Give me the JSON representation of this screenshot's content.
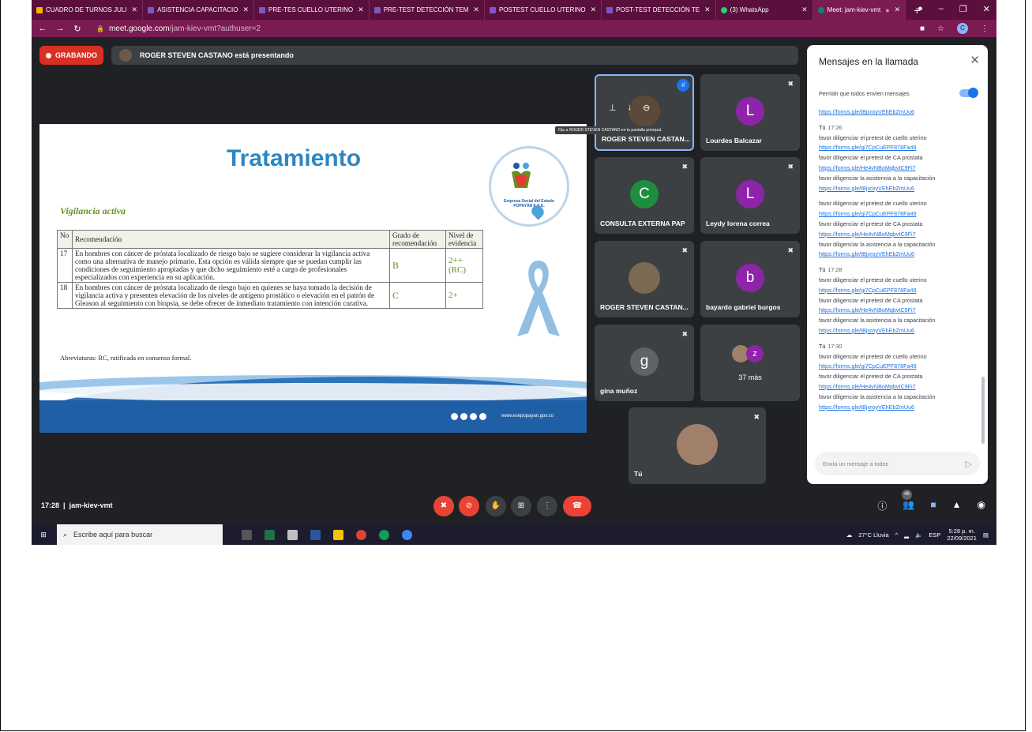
{
  "browser": {
    "tabs": [
      {
        "label": "CUADRO DE TURNOS JULI",
        "color": "#f4b400"
      },
      {
        "label": "ASISTENCIA CAPACITACIO",
        "color": "#7e57c2"
      },
      {
        "label": "PRE-TES CUELLO UTERINO",
        "color": "#7e57c2"
      },
      {
        "label": "PRE-TEST DETECCIÓN TEM",
        "color": "#7e57c2"
      },
      {
        "label": "POSTEST CUELLO UTERINO",
        "color": "#7e57c2"
      },
      {
        "label": "POST-TEST DETECCIÓN TE",
        "color": "#7e57c2"
      },
      {
        "label": "(3) WhatsApp",
        "color": "#25d366"
      },
      {
        "label": "Meet: jam-kiev-vmt",
        "color": "#00897b"
      }
    ],
    "new_tab": "+",
    "url_host": "meet.google.com",
    "url_path": "/jam-kiev-vmt?authuser=2",
    "profile_initial": "C"
  },
  "meet": {
    "recording_label": "GRABANDO",
    "presenting_text": "ROGER STEVEN CASTANO está presentando",
    "meeting_time": "17:28",
    "meeting_code": "jam-kiev-vmt",
    "participants_badge": "46",
    "pin_tooltip": "Fija a ROGER STEVEN CASTANO en tu pantalla principal."
  },
  "slide": {
    "title": "Tratamiento",
    "subtitle": "Vigilancia activa",
    "logo_text": "Empresa Social del Estado POPAYÁN E.S.E.",
    "table_headers": [
      "No",
      "Recomendación",
      "Grado de recomendación",
      "Nivel de evidencia"
    ],
    "rows": [
      {
        "no": "17",
        "text": "En hombres con cáncer de próstata localizado de riesgo bajo se sugiere considerar la vigilancia activa como una alternativa de manejo primario. Esta opción es válida siempre que se puedan cumplir las condiciones de seguimiento apropiadas y que dicho seguimiento esté a cargo de profesionales especializados con experiencia en su aplicación.",
        "grade": "B",
        "level": "2++ (RC)"
      },
      {
        "no": "18",
        "text": "En hombres con cáncer de próstata localizado de riesgo bajo en quienes se haya tomado la decisión de vigilancia activa y presenten elevación de los niveles de antígeno prostático o elevación en el patrón de Gleason al seguimiento con biopsia, se debe ofrecer de inmediato tratamiento con intención curativa.",
        "grade": "C",
        "level": "2+"
      }
    ],
    "abbreviations": "Abreviaturas: RC, ratificada en consenso formal.",
    "website": "www.esepopayan.gov.co"
  },
  "participants": [
    {
      "name": "ROGER STEVEN CASTAN...",
      "initial": "",
      "color": "#5b4a3a"
    },
    {
      "name": "Lourdes Balcazar",
      "initial": "L",
      "color": "#8e24aa"
    },
    {
      "name": "CONSULTA EXTERNA PAP",
      "initial": "C",
      "color": "#1e8e3e"
    },
    {
      "name": "Leydy lorena correa",
      "initial": "L",
      "color": "#8e24aa"
    },
    {
      "name": "ROGER STEVEN CASTAN...",
      "initial": "",
      "color": "#7a6a52"
    },
    {
      "name": "bayardo gabriel burgos",
      "initial": "b",
      "color": "#8e24aa"
    },
    {
      "name": "gina muñoz",
      "initial": "g",
      "color": "#5f6368"
    },
    {
      "name": "",
      "initial": "z",
      "color": "#8e24aa"
    },
    {
      "name": "Tú",
      "initial": "",
      "color": "#a0806a"
    }
  ],
  "more_count": "37 más",
  "chat": {
    "title": "Mensajes en la llamada",
    "allow_label": "Permitir que todos envíen mensajes",
    "input_placeholder": "Envía un mensaje a todos",
    "top_link": "https://forms.gle/tBjxroyVEhEbZmUu6",
    "groups": [
      {
        "sender": "Tú",
        "time": "17:26",
        "lines": [
          {
            "t": "favor diligenciar el pretest de cuello uterino",
            "link": false
          },
          {
            "t": "https://forms.gle/gi7CpCuEPF878Fa49",
            "link": true
          },
          {
            "t": "favor diligenciar el pretest de CA prostata",
            "link": false
          },
          {
            "t": "https://forms.gle/He4vNBoMqbvtC9Fi7",
            "link": true
          },
          {
            "t": "favor diligenciar la asistencia a la capacitación",
            "link": false
          },
          {
            "t": "https://forms.gle/tBjxroyVEhEbZmUu6",
            "link": true
          },
          {
            "t": "",
            "link": false
          },
          {
            "t": "favor diligenciar el pretest de cuello uterino",
            "link": false
          },
          {
            "t": "https://forms.gle/gi7CpCuEPF878Fa49",
            "link": true
          },
          {
            "t": "favor diligenciar el pretest de CA prostata",
            "link": false
          },
          {
            "t": "https://forms.gle/He4vNBoMqbvtC9Fi7",
            "link": true
          },
          {
            "t": "favor diligenciar la asistencia a la capacitación",
            "link": false
          },
          {
            "t": "https://forms.gle/tBjxroyVEhEbZmUu6",
            "link": true
          }
        ]
      },
      {
        "sender": "Tú",
        "time": "17:28",
        "lines": [
          {
            "t": "favor diligenciar el pretest de cuello uterino",
            "link": false
          },
          {
            "t": "https://forms.gle/gi7CpCuEPF878Fa49",
            "link": true
          },
          {
            "t": "favor diligenciar el pretest de CA prostata",
            "link": false
          },
          {
            "t": "https://forms.gle/He4vNBoMqbvtC9Fi7",
            "link": true
          },
          {
            "t": "favor diligenciar la asistencia a la capacitación",
            "link": false
          },
          {
            "t": "https://forms.gle/tBjxroyVEhEbZmUu6",
            "link": true
          }
        ]
      },
      {
        "sender": "Tú",
        "time": "17:30",
        "lines": [
          {
            "t": "favor diligenciar el pretest de cuello uterino",
            "link": false
          },
          {
            "t": "https://forms.gle/gi7CpCuEPF878Fa49",
            "link": true
          },
          {
            "t": "favor diligenciar el pretest de CA prostata",
            "link": false
          },
          {
            "t": "https://forms.gle/He4vNBoMqbvtC9Fi7",
            "link": true
          },
          {
            "t": "favor diligenciar la asistencia a la capacitación",
            "link": false
          },
          {
            "t": "https://forms.gle/tBjxroyVEhEbZmUu6",
            "link": true
          }
        ]
      }
    ]
  },
  "taskbar": {
    "search_placeholder": "Escribe aquí para buscar",
    "weather": "27°C Lluvia",
    "lang": "ESP",
    "time": "5:28 p. m.",
    "date": "22/09/2021"
  }
}
